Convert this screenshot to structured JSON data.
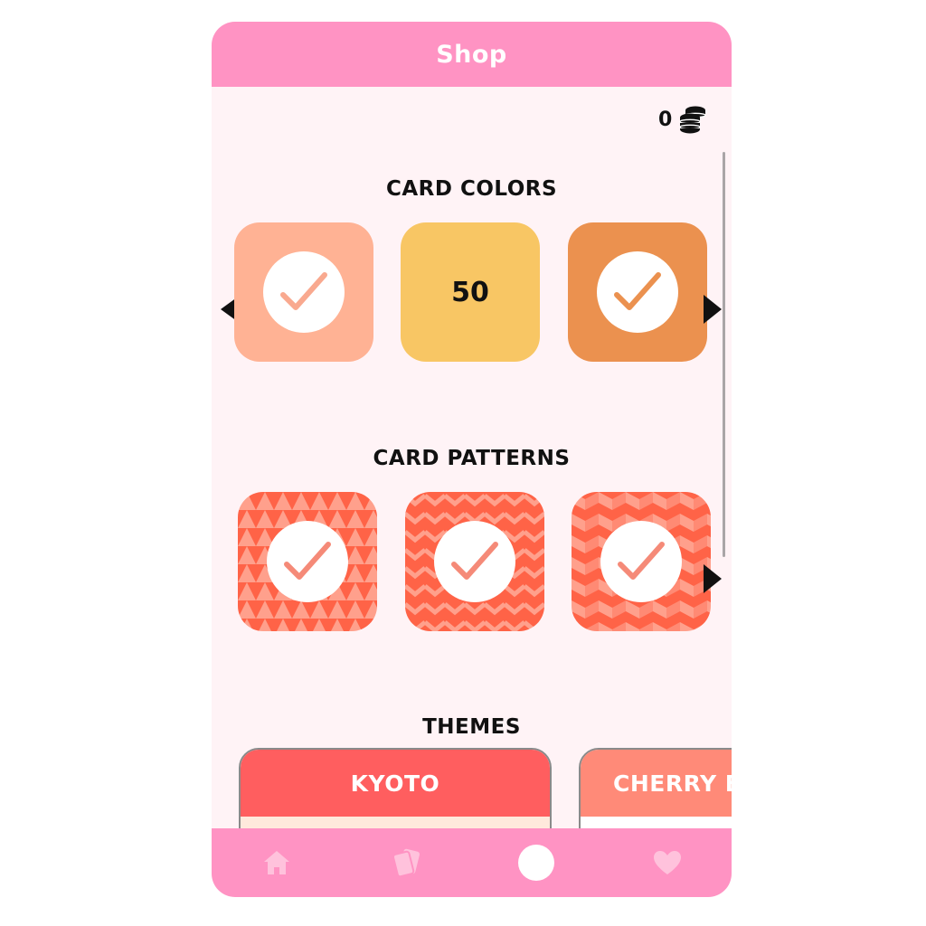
{
  "header": {
    "title": "Shop"
  },
  "coins": {
    "value": "0",
    "icon": "coins-icon"
  },
  "sections": {
    "card_colors": {
      "title": "CARD COLORS",
      "items": [
        {
          "color": "#ffb294",
          "state": "owned"
        },
        {
          "color": "#f8c664",
          "state": "price",
          "price": "50"
        },
        {
          "color": "#eb914f",
          "state": "owned"
        }
      ]
    },
    "card_patterns": {
      "title": "CARD PATTERNS",
      "items": [
        {
          "pattern": "triangles",
          "state": "owned"
        },
        {
          "pattern": "zigzag",
          "state": "owned"
        },
        {
          "pattern": "chevron",
          "state": "owned"
        }
      ]
    },
    "themes": {
      "title": "THEMES",
      "items": [
        {
          "name": "KYOTO",
          "color": "#ff5e5f"
        },
        {
          "name": "CHERRY B",
          "color": "#ff8a78"
        }
      ]
    }
  },
  "colors": {
    "header": "#ff93c3",
    "background": "#fff3f6",
    "pattern_base": "#ff6347",
    "pattern_light": "#ffa08c",
    "check": "#f58a78"
  },
  "nav": [
    {
      "icon": "home-icon"
    },
    {
      "icon": "cards-icon"
    },
    {
      "icon": "shop-circle-icon"
    },
    {
      "icon": "heart-icon"
    }
  ]
}
